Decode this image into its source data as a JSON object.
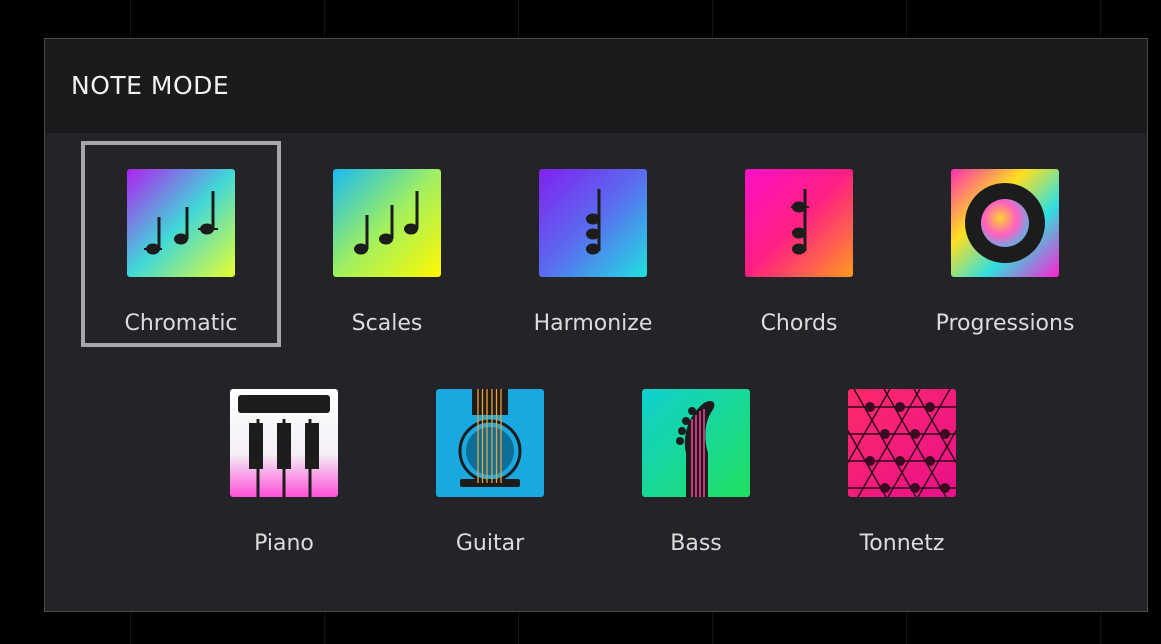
{
  "dialog": {
    "title": "NOTE MODE",
    "selected_mode": "Chromatic"
  },
  "modes": [
    {
      "id": "chromatic",
      "label": "Chromatic",
      "icon": "chromatic-notes-icon",
      "selected": true
    },
    {
      "id": "scales",
      "label": "Scales",
      "icon": "scale-notes-icon",
      "selected": false
    },
    {
      "id": "harmonize",
      "label": "Harmonize",
      "icon": "harmonize-notes-icon",
      "selected": false
    },
    {
      "id": "chords",
      "label": "Chords",
      "icon": "chord-notes-icon",
      "selected": false
    },
    {
      "id": "progressions",
      "label": "Progressions",
      "icon": "progression-ring-icon",
      "selected": false
    },
    {
      "id": "piano",
      "label": "Piano",
      "icon": "piano-keys-icon",
      "selected": false
    },
    {
      "id": "guitar",
      "label": "Guitar",
      "icon": "guitar-body-icon",
      "selected": false
    },
    {
      "id": "bass",
      "label": "Bass",
      "icon": "bass-headstock-icon",
      "selected": false
    },
    {
      "id": "tonnetz",
      "label": "Tonnetz",
      "icon": "tonnetz-grid-icon",
      "selected": false
    }
  ],
  "colors": {
    "dialog_background": "#242428",
    "header_background": "#1b1b1d",
    "selection_border": "#a7a7a9",
    "label_text": "#dcdcdc"
  }
}
